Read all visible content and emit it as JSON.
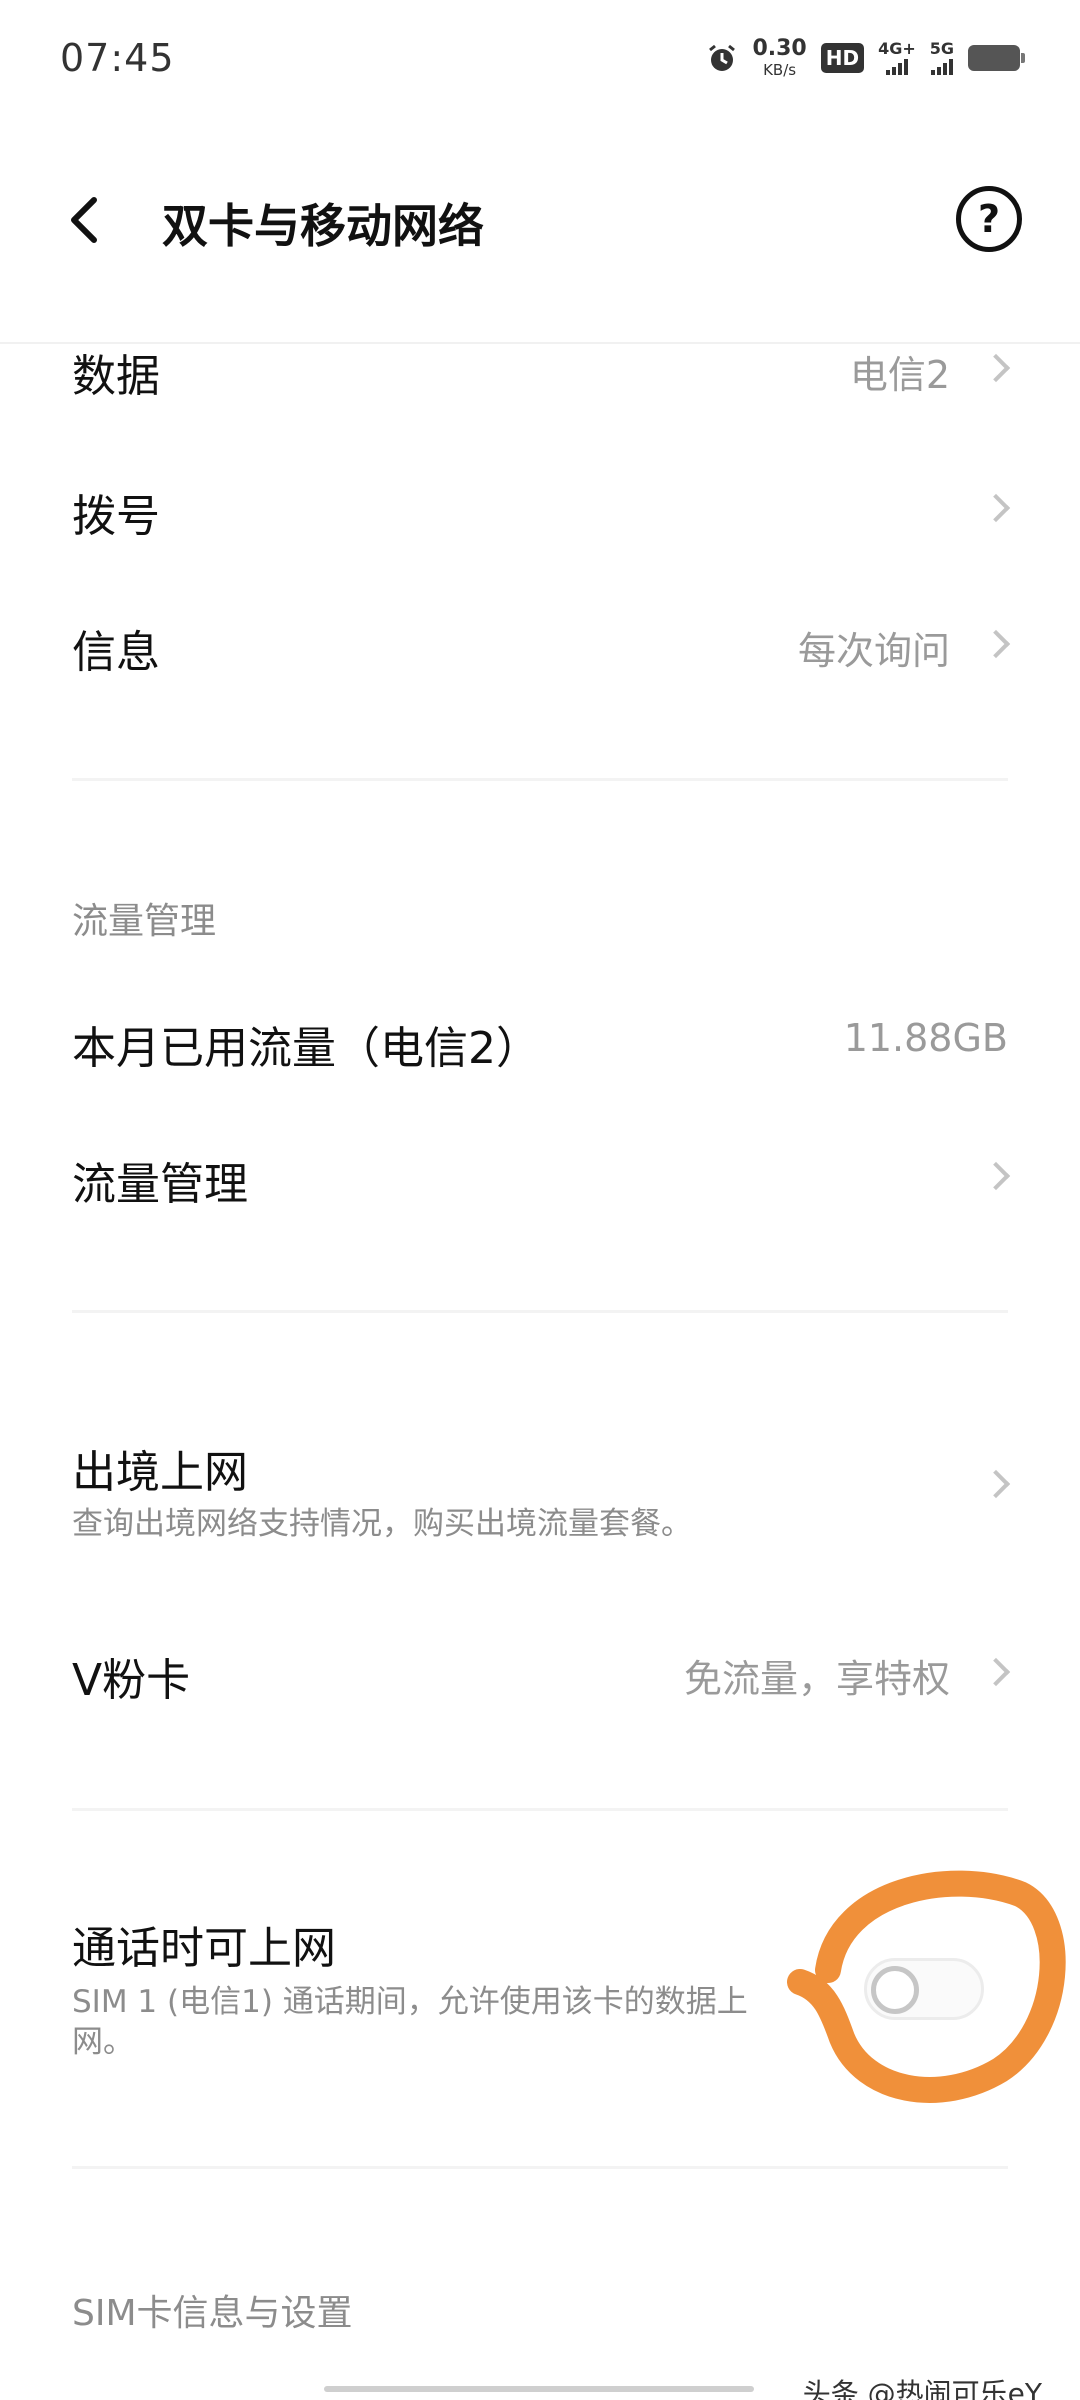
{
  "status_bar": {
    "time": "07:45",
    "net_speed_value": "0.30",
    "net_speed_unit": "KB/s",
    "hd_label": "HD",
    "sim1_network": "4G+",
    "sim2_network": "5G",
    "icons": [
      "alarm-icon",
      "hd-icon",
      "signal-icon",
      "battery-icon"
    ]
  },
  "header": {
    "title": "双卡与移动网络",
    "help_symbol": "?"
  },
  "rows": {
    "data": {
      "title": "数据",
      "value": "电信2"
    },
    "dial": {
      "title": "拨号"
    },
    "message": {
      "title": "信息",
      "value": "每次询问"
    }
  },
  "traffic_section": {
    "header": "流量管理",
    "monthly_usage": {
      "title": "本月已用流量（电信2）",
      "value": "11.88GB"
    },
    "traffic_management": {
      "title": "流量管理"
    }
  },
  "roaming": {
    "title": "出境上网",
    "subtitle": "查询出境网络支持情况，购买出境流量套餐。"
  },
  "vfan": {
    "title": "V粉卡",
    "value": "免流量，享特权"
  },
  "call_data": {
    "title": "通话时可上网",
    "subtitle_line1": "SIM 1 (电信1) 通话期间，允许使用该卡的数据上",
    "subtitle_line2": "网。",
    "toggle_on": false
  },
  "sim_section": {
    "header": "SIM卡信息与设置"
  },
  "watermark": "头条 @热闹可乐eY",
  "colors": {
    "annotation": "#F0903A",
    "secondary_text": "#9A9A9A",
    "primary_text": "#111111"
  }
}
